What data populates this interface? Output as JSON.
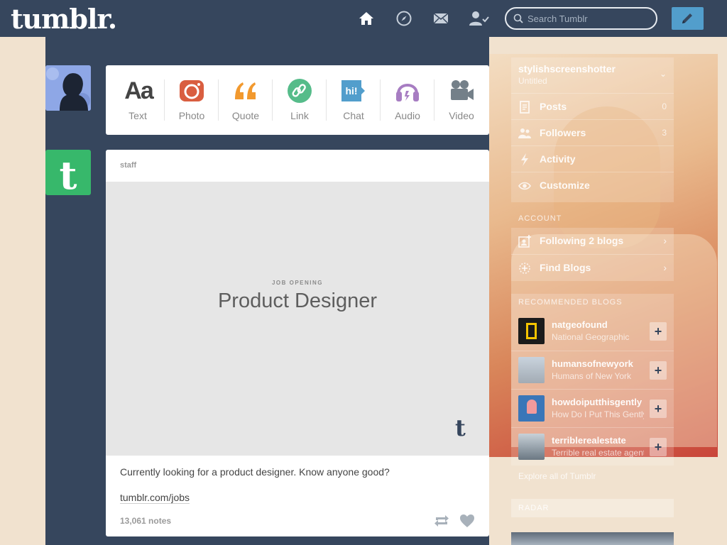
{
  "header": {
    "logo": "tumblr.",
    "search_placeholder": "Search Tumblr",
    "icons": [
      "home-icon",
      "explore-icon",
      "mail-icon",
      "account-icon",
      "pencil-icon"
    ]
  },
  "post_types": [
    {
      "label": "Text",
      "icon": "text-icon",
      "color": "#444444"
    },
    {
      "label": "Photo",
      "icon": "camera-icon",
      "color": "#d95e40"
    },
    {
      "label": "Quote",
      "icon": "quote-icon",
      "color": "#f2992e"
    },
    {
      "label": "Link",
      "icon": "link-icon",
      "color": "#56bc8a"
    },
    {
      "label": "Chat",
      "icon": "chat-icon",
      "color": "#529ecc"
    },
    {
      "label": "Audio",
      "icon": "headphones-icon",
      "color": "#a77dc2"
    },
    {
      "label": "Video",
      "icon": "video-camera-icon",
      "color": "#748089"
    }
  ],
  "post": {
    "author": "staff",
    "image_kicker": "JOB OPENING",
    "image_title": "Product Designer",
    "text": "Currently looking for a product designer. Know anyone good?",
    "link": "tumblr.com/jobs",
    "notes": "13,061 notes"
  },
  "sidebar": {
    "blog_name": "stylishscreenshotter",
    "blog_sub": "Untitled",
    "blog_items": [
      {
        "label": "Posts",
        "count": "0",
        "icon": "posts-icon"
      },
      {
        "label": "Followers",
        "count": "3",
        "icon": "followers-icon"
      },
      {
        "label": "Activity",
        "count": "",
        "icon": "activity-icon"
      },
      {
        "label": "Customize",
        "count": "",
        "icon": "eye-icon"
      }
    ],
    "account_label": "ACCOUNT",
    "account_items": [
      {
        "label": "Following 2 blogs",
        "icon": "following-icon"
      },
      {
        "label": "Find Blogs",
        "icon": "find-blogs-icon"
      }
    ],
    "recommended_label": "RECOMMENDED BLOGS",
    "recommended": [
      {
        "name": "natgeofound",
        "sub": "National Geographic",
        "thumb_color": "#1b1b1b"
      },
      {
        "name": "humansofnewyork",
        "sub": "Humans of New York",
        "thumb_color": "#b9c2cc"
      },
      {
        "name": "howdoiputthisgently",
        "sub": "How Do I Put This Gently",
        "thumb_color": "#3a76b8"
      },
      {
        "name": "terriblerealestate",
        "sub": "Terrible real estate agent",
        "thumb_color": "#7d8b95"
      }
    ],
    "explore_link": "Explore all of Tumblr",
    "radar_label": "RADAR"
  }
}
